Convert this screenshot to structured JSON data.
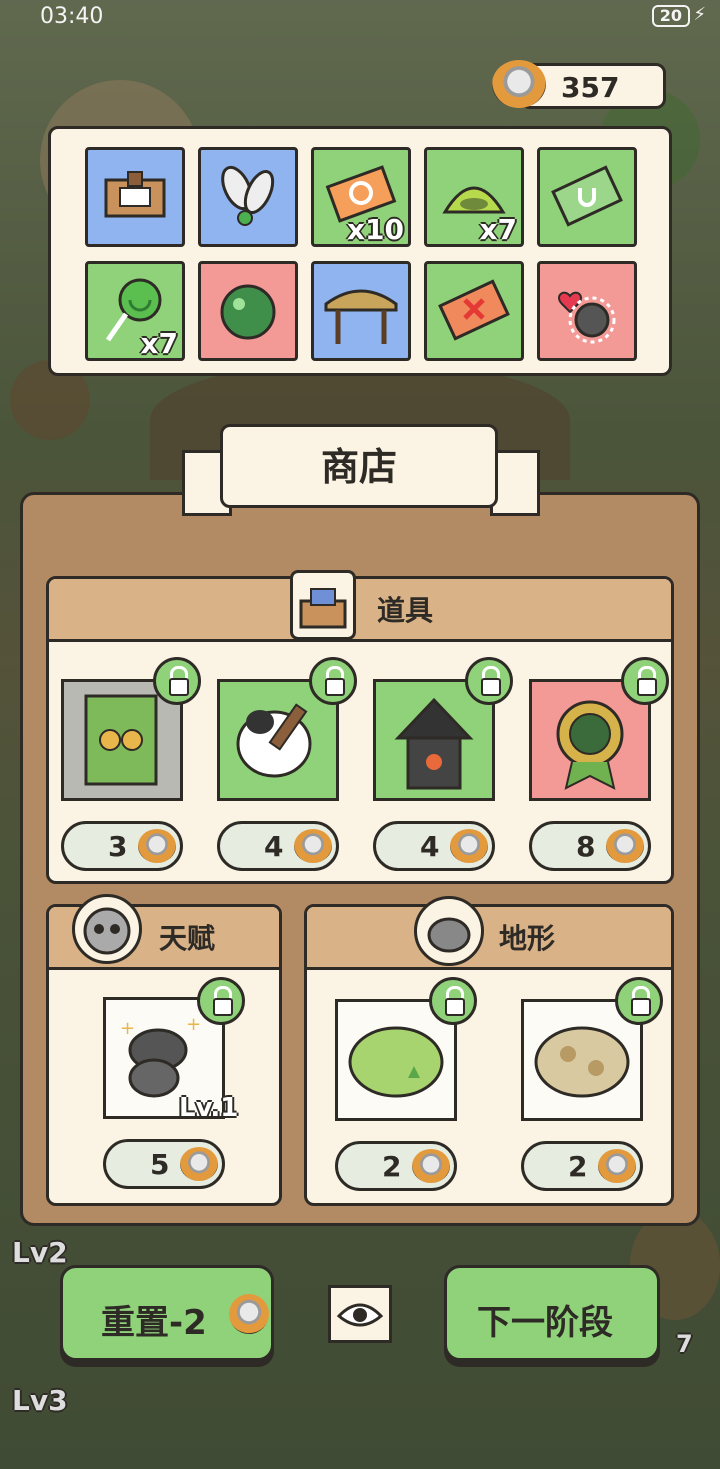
{
  "status_bar": {
    "time": "03:40",
    "battery": "20"
  },
  "currency": {
    "cans": "357",
    "icon": "cat-food-can-icon"
  },
  "items": [
    {
      "name": "box-frame",
      "color": "blue",
      "qty": ""
    },
    {
      "name": "leaf-pair",
      "color": "blue",
      "qty": ""
    },
    {
      "name": "refresh-ticket",
      "color": "green",
      "qty": "x10"
    },
    {
      "name": "green-tent",
      "color": "green",
      "qty": "x7"
    },
    {
      "name": "u-ticket",
      "color": "green",
      "qty": ""
    },
    {
      "name": "lollipop",
      "color": "green",
      "qty": "x7"
    },
    {
      "name": "green-orb",
      "color": "red",
      "qty": ""
    },
    {
      "name": "straw-hut",
      "color": "blue",
      "qty": ""
    },
    {
      "name": "x-ticket",
      "color": "green",
      "qty": ""
    },
    {
      "name": "love-mouse",
      "color": "red",
      "qty": ""
    }
  ],
  "shop": {
    "title": "商店",
    "props": {
      "title": "道具",
      "cards": [
        {
          "name": "paw-card",
          "price": "3"
        },
        {
          "name": "paint-brush",
          "price": "4"
        },
        {
          "name": "haunted-house",
          "price": "4"
        },
        {
          "name": "medal",
          "price": "8"
        }
      ]
    },
    "talent": {
      "title": "天赋",
      "card": {
        "name": "mice-talent",
        "level": "Lv.1",
        "price": "5"
      }
    },
    "terrain": {
      "title": "地形",
      "cards": [
        {
          "name": "grass-terrain",
          "price": "2"
        },
        {
          "name": "dirt-terrain",
          "price": "2"
        }
      ]
    }
  },
  "bottom": {
    "reset_label": "重置-2",
    "next_label": "下一阶段",
    "side_levels": [
      "Lv2",
      "Lv3"
    ],
    "side_count": "7"
  },
  "colors": {
    "board": "#b28a63",
    "panel": "#fbf3e3",
    "green": "#8fd27a",
    "red": "#f39a97",
    "blue": "#8fb4f0",
    "ink": "#2e2a25"
  }
}
